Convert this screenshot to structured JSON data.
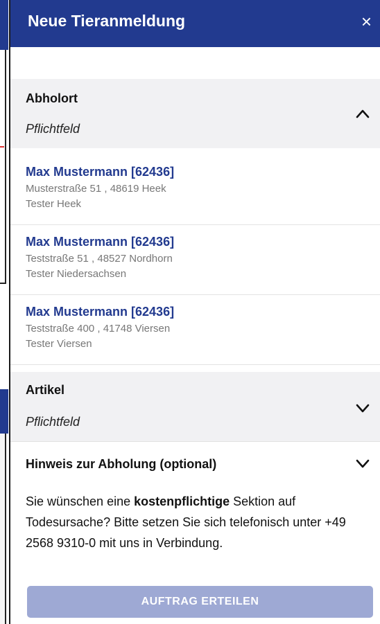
{
  "dialog": {
    "title": "Neue Tieranmeldung",
    "close_symbol": "×"
  },
  "abholort": {
    "title": "Abholort",
    "subtitle": "Pflichtfeld",
    "icon": "chevron-up-icon",
    "items": [
      {
        "name": "Max Mustermann [62436]",
        "street": "Musterstraße 51 , 48619 Heek",
        "org": "Tester Heek"
      },
      {
        "name": "Max Mustermann [62436]",
        "street": "Teststraße 51 , 48527 Nordhorn",
        "org": "Tester Niedersachsen"
      },
      {
        "name": "Max Mustermann [62436]",
        "street": "Teststraße 400 , 41748 Viersen",
        "org": "Tester Viersen"
      }
    ]
  },
  "artikel": {
    "title": "Artikel",
    "subtitle": "Pflichtfeld",
    "icon": "chevron-down-icon"
  },
  "hinweis": {
    "title": "Hinweis zur Abholung (optional)",
    "icon": "chevron-down-icon"
  },
  "info": {
    "before": "Sie wünschen eine ",
    "bold": "kostenpflichtige",
    "after": " Sektion auf Todesursache? Bitte setzen Sie sich telefonisch unter +49 2568 9310-0 mit uns in Verbindung."
  },
  "submit_label": "AUFTRAG ERTEILEN",
  "colors": {
    "header": "#223a8f",
    "link": "#223a8f",
    "button_disabled": "#9ea9d4",
    "section_bg": "#f1f1f3"
  }
}
